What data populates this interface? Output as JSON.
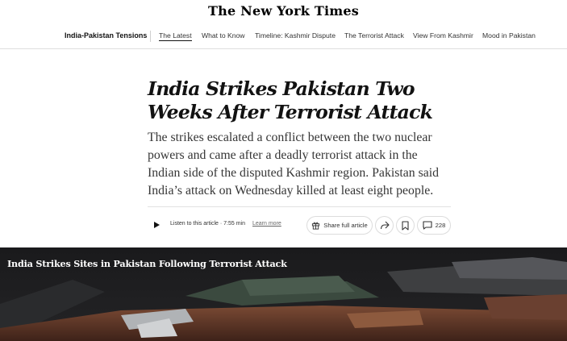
{
  "masthead": {
    "logo": "The New York Times"
  },
  "subnav": {
    "section": "India-Pakistan Tensions",
    "items": [
      {
        "label": "The Latest"
      },
      {
        "label": "What to Know"
      },
      {
        "label": "Timeline: Kashmir Dispute"
      },
      {
        "label": "The Terrorist Attack"
      },
      {
        "label": "View From Kashmir"
      },
      {
        "label": "Mood in Pakistan"
      }
    ]
  },
  "article": {
    "headline": "India Strikes Pakistan Two Weeks After Terrorist Attack",
    "summary": "The strikes escalated a conflict between the two nuclear powers and came after a deadly terrorist attack in the Indian side of the disputed Kashmir region. Pakistan said India’s attack on Wednesday killed at least eight people."
  },
  "toolbar": {
    "listen_label": "Listen to this article · 7:55 min",
    "learn_more": "Learn more",
    "share_full_article": "Share full article",
    "comment_count": "228"
  },
  "photo": {
    "title": "India Strikes Sites in Pakistan Following Terrorist Attack"
  },
  "icons": {
    "play": "play-icon",
    "gift": "gift-icon",
    "share": "share-arrow-icon",
    "bookmark": "bookmark-icon",
    "comment": "comment-icon"
  },
  "colors": {
    "text": "#121212",
    "summary": "#363636",
    "divider": "#dfdfdf",
    "photo_bg": "#1b1b1d"
  }
}
